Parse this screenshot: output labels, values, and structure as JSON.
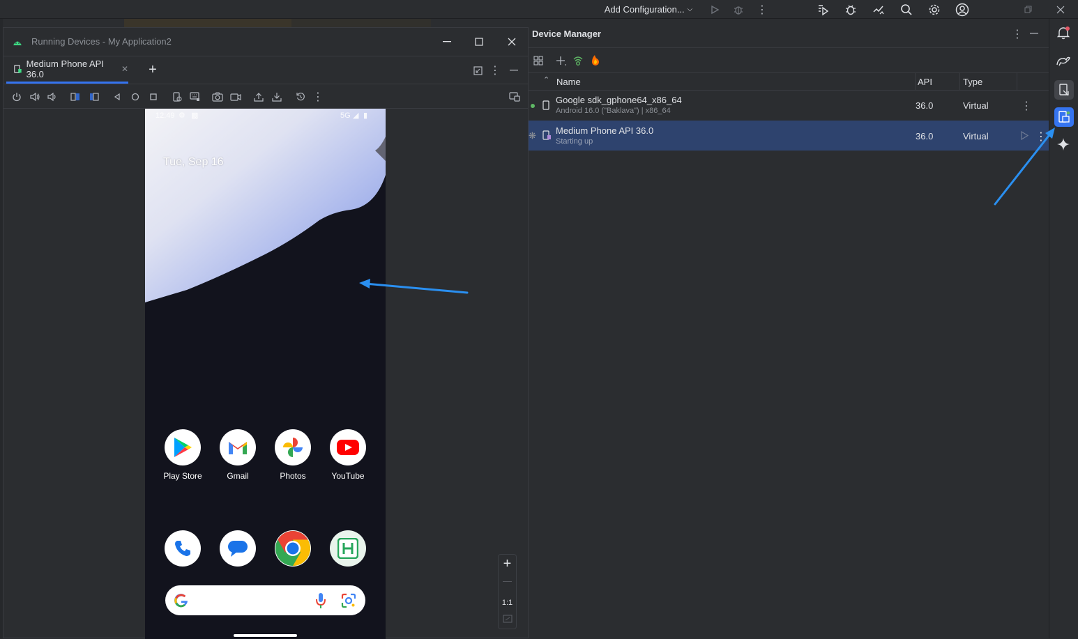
{
  "topbar": {
    "run_config_label": "Add Configuration...",
    "icons": [
      "chevron-down-icon",
      "run-icon",
      "debug-icon",
      "more-icon",
      "profile-run-icon",
      "bug-settings-icon",
      "sync-icon",
      "search-icon",
      "gear-icon",
      "account-icon",
      "restore-icon",
      "close-icon"
    ]
  },
  "running_devices": {
    "window_title": "Running Devices - My Application2",
    "tab_label": "Medium Phone API 36.0",
    "toolbar_icons": [
      "power-icon",
      "volume-up-icon",
      "volume-down-icon",
      "rotate-left-icon",
      "rotate-right-icon",
      "back-icon",
      "home-icon",
      "overview-icon",
      "snapshot-icon",
      "keyboard-icon",
      "screenshot-icon",
      "screen-record-icon",
      "upload-icon",
      "download-icon",
      "reset-icon",
      "more-icon",
      "mirror-icon"
    ]
  },
  "phone": {
    "status_time": "12:49",
    "status_network": "5G",
    "date": "Tue, Sep 16",
    "apps_row1": [
      {
        "label": "Play Store",
        "icon": "play-store-icon"
      },
      {
        "label": "Gmail",
        "icon": "gmail-icon"
      },
      {
        "label": "Photos",
        "icon": "photos-icon"
      },
      {
        "label": "YouTube",
        "icon": "youtube-icon"
      }
    ],
    "apps_row2": [
      {
        "icon": "phone-icon"
      },
      {
        "icon": "messages-icon"
      },
      {
        "icon": "chrome-icon"
      },
      {
        "icon": "h-app-icon"
      }
    ],
    "search_icons": [
      "google-icon",
      "mic-icon",
      "lens-icon"
    ]
  },
  "zoom": {
    "plus": "+",
    "minus": "—",
    "one_to_one": "1:1"
  },
  "device_manager": {
    "title": "Device Manager",
    "columns": {
      "name": "Name",
      "api": "API",
      "type": "Type"
    },
    "devices": [
      {
        "name": "Google sdk_gphone64_x86_64",
        "subtitle": "Android 16.0 (\"Baklava\") | x86_64",
        "api": "36.0",
        "type": "Virtual",
        "status_color": "#5fb865"
      },
      {
        "name": "Medium Phone API 36.0",
        "subtitle": "Starting up",
        "api": "36.0",
        "type": "Virtual",
        "selected": true
      }
    ]
  },
  "colors": {
    "accent": "#3574f0",
    "selected_row": "#2e436e",
    "annotation_arrow": "#2a8ff0"
  }
}
